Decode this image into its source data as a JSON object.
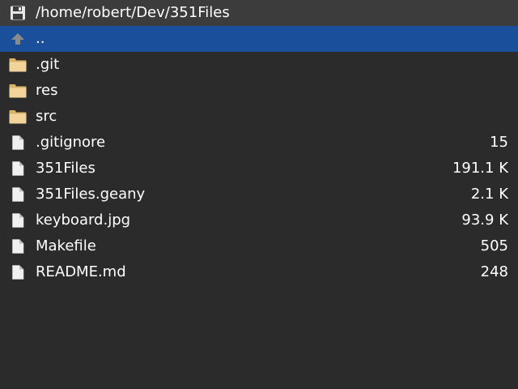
{
  "header": {
    "path": "/home/robert/Dev/351Files",
    "icon": "floppy-disk-icon"
  },
  "colors": {
    "background": "#2b2b2b",
    "header_background": "#3c3c3c",
    "selection": "#1a4f9c",
    "folder": "#f2d49a",
    "file": "#f0f0f0"
  },
  "entries": [
    {
      "name": "..",
      "size": "",
      "type": "parent",
      "icon": "up-arrow-icon",
      "selected": true
    },
    {
      "name": ".git",
      "size": "",
      "type": "folder",
      "icon": "folder-icon",
      "selected": false
    },
    {
      "name": "res",
      "size": "",
      "type": "folder",
      "icon": "folder-icon",
      "selected": false
    },
    {
      "name": "src",
      "size": "",
      "type": "folder",
      "icon": "folder-icon",
      "selected": false
    },
    {
      "name": ".gitignore",
      "size": "15",
      "type": "file",
      "icon": "file-icon",
      "selected": false
    },
    {
      "name": "351Files",
      "size": "191.1 K",
      "type": "file",
      "icon": "file-icon",
      "selected": false
    },
    {
      "name": "351Files.geany",
      "size": "2.1 K",
      "type": "file",
      "icon": "file-icon",
      "selected": false
    },
    {
      "name": "keyboard.jpg",
      "size": "93.9 K",
      "type": "file",
      "icon": "file-icon",
      "selected": false
    },
    {
      "name": "Makefile",
      "size": "505",
      "type": "file",
      "icon": "file-icon",
      "selected": false
    },
    {
      "name": "README.md",
      "size": "248",
      "type": "file",
      "icon": "file-icon",
      "selected": false
    }
  ]
}
